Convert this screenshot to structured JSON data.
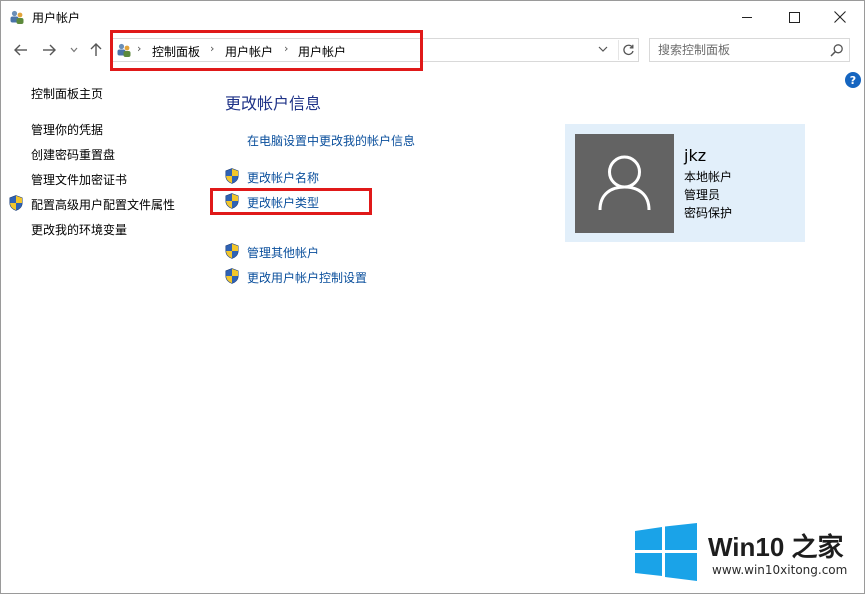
{
  "window": {
    "title": "用户帐户"
  },
  "nav": {
    "breadcrumbs": [
      "控制面板",
      "用户帐户",
      "用户帐户"
    ],
    "search_placeholder": "搜索控制面板"
  },
  "left_pane": {
    "items": [
      "控制面板主页",
      "管理你的凭据",
      "创建密码重置盘",
      "管理文件加密证书",
      "配置高级用户配置文件属性",
      "更改我的环境变量"
    ]
  },
  "main": {
    "heading": "更改帐户信息",
    "pc_settings_link": "在电脑设置中更改我的帐户信息",
    "links": [
      "更改帐户名称",
      "更改帐户类型",
      "管理其他帐户",
      "更改用户帐户控制设置"
    ]
  },
  "account": {
    "name": "jkz",
    "details": [
      "本地帐户",
      "管理员",
      "密码保护"
    ]
  },
  "watermark": {
    "title": "Win10 之家",
    "url": "www.win10xitong.com"
  },
  "colors": {
    "link": "#0a4f9c",
    "heading": "#1e3287",
    "card_bg": "#e2effa",
    "annotation": "#e01919",
    "win_blue": "#1aa3e8"
  }
}
